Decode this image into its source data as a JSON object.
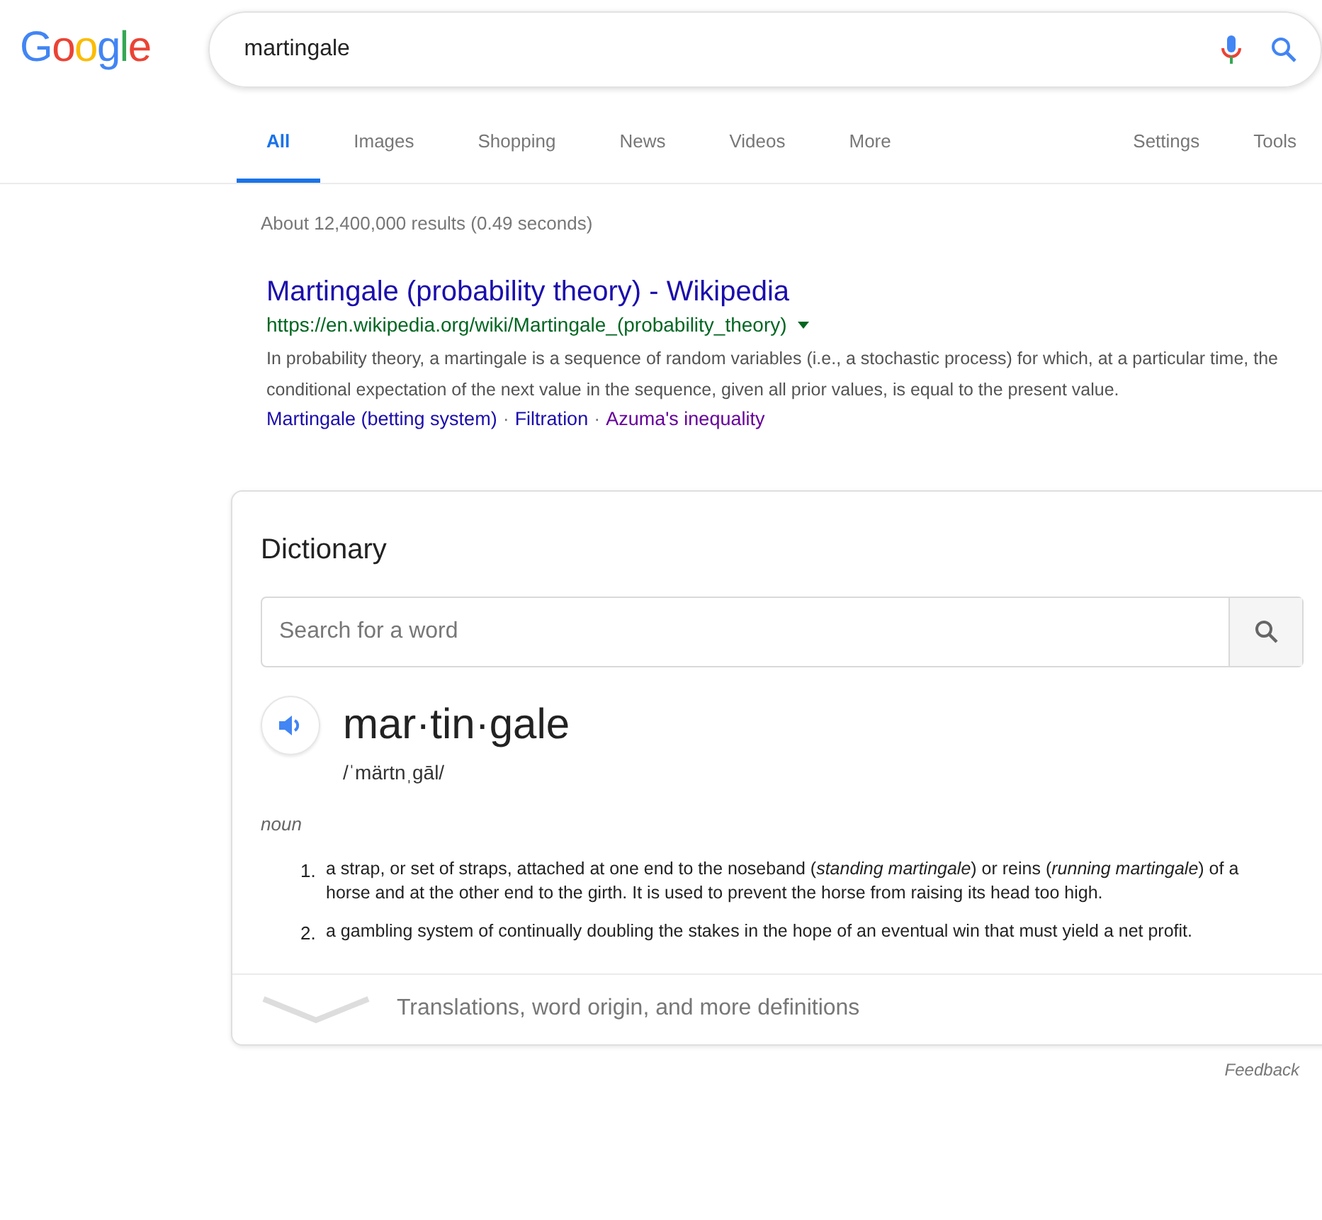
{
  "logo": "Google",
  "search": {
    "value": "martingale"
  },
  "tabs": [
    {
      "label": "All",
      "selected": true
    },
    {
      "label": "Images",
      "selected": false
    },
    {
      "label": "Shopping",
      "selected": false
    },
    {
      "label": "News",
      "selected": false
    },
    {
      "label": "Videos",
      "selected": false
    },
    {
      "label": "More",
      "selected": false
    }
  ],
  "tools": [
    "Settings",
    "Tools"
  ],
  "result_stats": "About 12,400,000 results (0.49 seconds)",
  "result": {
    "title": "Martingale (probability theory) - Wikipedia",
    "url": "https://en.wikipedia.org/wiki/Martingale_(probability_theory)",
    "snippet": "In probability theory, a martingale is a sequence of random variables (i.e., a stochastic process) for which, at a particular time, the conditional expectation of the next value in the sequence, given all prior values, is equal to the present value.",
    "links": [
      {
        "label": "Martingale (betting system)",
        "visited": false
      },
      {
        "label": "Filtration",
        "visited": false,
        "separator": "·"
      },
      {
        "label": "Azuma's inequality",
        "visited": true,
        "separator": "·"
      }
    ]
  },
  "dictionary": {
    "heading": "Dictionary",
    "search_placeholder": "Search for a word",
    "word": "mar·tin·gale",
    "phonetic": "/ˈmärtnˌɡāl/",
    "part_of_speech": "noun",
    "definitions": [
      {
        "number": "1.",
        "text": "a strap, or set of straps, attached at one end to the noseband (*standing martingale*) or reins (*running martingale*) of a horse and at the other end to the girth. It is used to prevent the horse from raising its head too high."
      },
      {
        "number": "2.",
        "text": "a gambling system of continually doubling the stakes in the hope of an eventual win that must yield a net profit."
      }
    ],
    "more": "Translations, word origin, and more definitions"
  },
  "feedback": "Feedback"
}
